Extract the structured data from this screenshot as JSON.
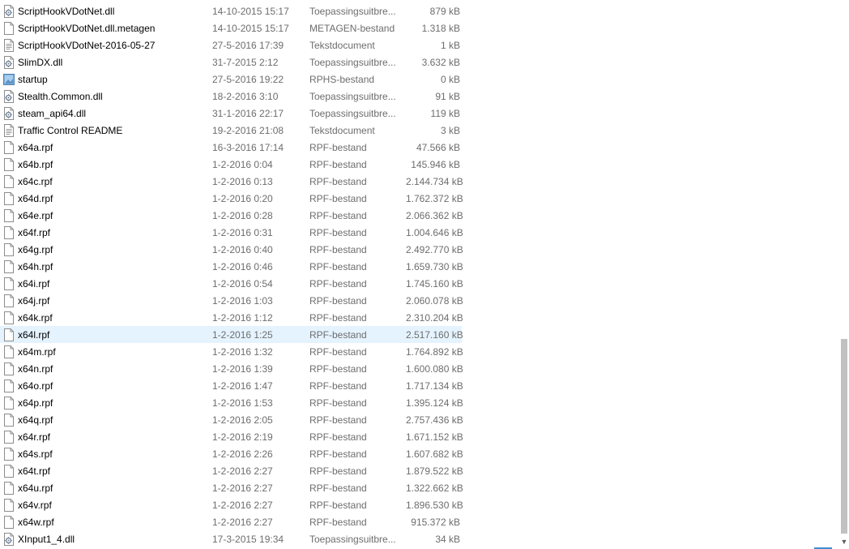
{
  "files": [
    {
      "name": "ScriptHookVDotNet.dll",
      "date": "14-10-2015 15:17",
      "type": "Toepassingsuitbre...",
      "size": "879 kB",
      "icon": "dll-file-icon"
    },
    {
      "name": "ScriptHookVDotNet.dll.metagen",
      "date": "14-10-2015 15:17",
      "type": "METAGEN-bestand",
      "size": "1.318 kB",
      "icon": "blank-file-icon"
    },
    {
      "name": "ScriptHookVDotNet-2016-05-27",
      "date": "27-5-2016 17:39",
      "type": "Tekstdocument",
      "size": "1 kB",
      "icon": "text-file-icon"
    },
    {
      "name": "SlimDX.dll",
      "date": "31-7-2015 2:12",
      "type": "Toepassingsuitbre...",
      "size": "3.632 kB",
      "icon": "dll-file-icon"
    },
    {
      "name": "startup",
      "date": "27-5-2016 19:22",
      "type": "RPHS-bestand",
      "size": "0 kB",
      "icon": "rphs-file-icon"
    },
    {
      "name": "Stealth.Common.dll",
      "date": "18-2-2016 3:10",
      "type": "Toepassingsuitbre...",
      "size": "91 kB",
      "icon": "dll-file-icon"
    },
    {
      "name": "steam_api64.dll",
      "date": "31-1-2016 22:17",
      "type": "Toepassingsuitbre...",
      "size": "119 kB",
      "icon": "dll-file-icon"
    },
    {
      "name": "Traffic Control README",
      "date": "19-2-2016 21:08",
      "type": "Tekstdocument",
      "size": "3 kB",
      "icon": "text-file-icon"
    },
    {
      "name": "x64a.rpf",
      "date": "16-3-2016 17:14",
      "type": "RPF-bestand",
      "size": "47.566 kB",
      "icon": "blank-file-icon"
    },
    {
      "name": "x64b.rpf",
      "date": "1-2-2016 0:04",
      "type": "RPF-bestand",
      "size": "145.946 kB",
      "icon": "blank-file-icon"
    },
    {
      "name": "x64c.rpf",
      "date": "1-2-2016 0:13",
      "type": "RPF-bestand",
      "size": "2.144.734 kB",
      "icon": "blank-file-icon"
    },
    {
      "name": "x64d.rpf",
      "date": "1-2-2016 0:20",
      "type": "RPF-bestand",
      "size": "1.762.372 kB",
      "icon": "blank-file-icon"
    },
    {
      "name": "x64e.rpf",
      "date": "1-2-2016 0:28",
      "type": "RPF-bestand",
      "size": "2.066.362 kB",
      "icon": "blank-file-icon"
    },
    {
      "name": "x64f.rpf",
      "date": "1-2-2016 0:31",
      "type": "RPF-bestand",
      "size": "1.004.646 kB",
      "icon": "blank-file-icon"
    },
    {
      "name": "x64g.rpf",
      "date": "1-2-2016 0:40",
      "type": "RPF-bestand",
      "size": "2.492.770 kB",
      "icon": "blank-file-icon"
    },
    {
      "name": "x64h.rpf",
      "date": "1-2-2016 0:46",
      "type": "RPF-bestand",
      "size": "1.659.730 kB",
      "icon": "blank-file-icon"
    },
    {
      "name": "x64i.rpf",
      "date": "1-2-2016 0:54",
      "type": "RPF-bestand",
      "size": "1.745.160 kB",
      "icon": "blank-file-icon"
    },
    {
      "name": "x64j.rpf",
      "date": "1-2-2016 1:03",
      "type": "RPF-bestand",
      "size": "2.060.078 kB",
      "icon": "blank-file-icon"
    },
    {
      "name": "x64k.rpf",
      "date": "1-2-2016 1:12",
      "type": "RPF-bestand",
      "size": "2.310.204 kB",
      "icon": "blank-file-icon"
    },
    {
      "name": "x64l.rpf",
      "date": "1-2-2016 1:25",
      "type": "RPF-bestand",
      "size": "2.517.160 kB",
      "icon": "blank-file-icon",
      "selected": true
    },
    {
      "name": "x64m.rpf",
      "date": "1-2-2016 1:32",
      "type": "RPF-bestand",
      "size": "1.764.892 kB",
      "icon": "blank-file-icon"
    },
    {
      "name": "x64n.rpf",
      "date": "1-2-2016 1:39",
      "type": "RPF-bestand",
      "size": "1.600.080 kB",
      "icon": "blank-file-icon"
    },
    {
      "name": "x64o.rpf",
      "date": "1-2-2016 1:47",
      "type": "RPF-bestand",
      "size": "1.717.134 kB",
      "icon": "blank-file-icon"
    },
    {
      "name": "x64p.rpf",
      "date": "1-2-2016 1:53",
      "type": "RPF-bestand",
      "size": "1.395.124 kB",
      "icon": "blank-file-icon"
    },
    {
      "name": "x64q.rpf",
      "date": "1-2-2016 2:05",
      "type": "RPF-bestand",
      "size": "2.757.436 kB",
      "icon": "blank-file-icon"
    },
    {
      "name": "x64r.rpf",
      "date": "1-2-2016 2:19",
      "type": "RPF-bestand",
      "size": "1.671.152 kB",
      "icon": "blank-file-icon"
    },
    {
      "name": "x64s.rpf",
      "date": "1-2-2016 2:26",
      "type": "RPF-bestand",
      "size": "1.607.682 kB",
      "icon": "blank-file-icon"
    },
    {
      "name": "x64t.rpf",
      "date": "1-2-2016 2:27",
      "type": "RPF-bestand",
      "size": "1.879.522 kB",
      "icon": "blank-file-icon"
    },
    {
      "name": "x64u.rpf",
      "date": "1-2-2016 2:27",
      "type": "RPF-bestand",
      "size": "1.322.662 kB",
      "icon": "blank-file-icon"
    },
    {
      "name": "x64v.rpf",
      "date": "1-2-2016 2:27",
      "type": "RPF-bestand",
      "size": "1.896.530 kB",
      "icon": "blank-file-icon"
    },
    {
      "name": "x64w.rpf",
      "date": "1-2-2016 2:27",
      "type": "RPF-bestand",
      "size": "915.372 kB",
      "icon": "blank-file-icon"
    },
    {
      "name": "XInput1_4.dll",
      "date": "17-3-2015 19:34",
      "type": "Toepassingsuitbre...",
      "size": "34 kB",
      "icon": "dll-file-icon"
    }
  ],
  "colors": {
    "selected_row": "#e5f3ff",
    "secondary_text": "#6d6d6d",
    "scrollbar_thumb": "#c1c1c1",
    "accent": "#3d8fd1"
  }
}
